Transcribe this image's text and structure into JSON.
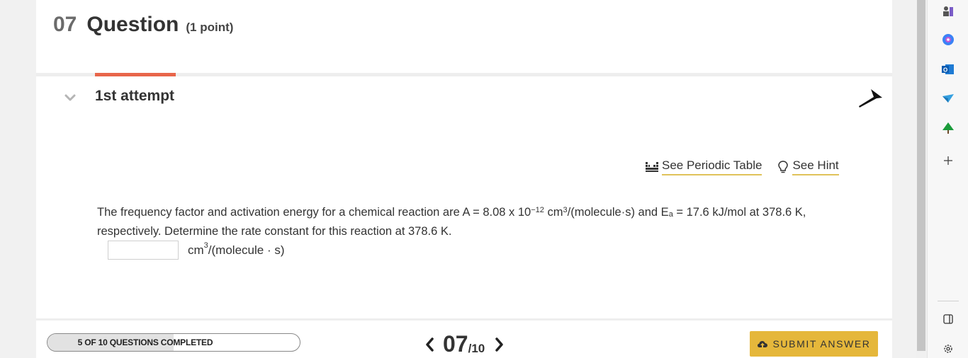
{
  "question": {
    "number": "07",
    "title": "Question",
    "points": "(1 point)",
    "attempt": "1st attempt"
  },
  "links": {
    "periodic_table": "See Periodic Table",
    "hint": "See Hint"
  },
  "body": {
    "t1": "The frequency factor and activation energy for a chemical reaction are A = 8.08  x 10",
    "exp1": "−12",
    "t2": " cm",
    "exp2": "3",
    "t3": "/(molecule·s) and E",
    "sub1": "a",
    "t4": " = 17.6  kJ/mol at 378.6  K, respectively. Determine the rate constant for this reaction at 378.6  K."
  },
  "answer": {
    "value": "",
    "unit_base": "cm",
    "unit_exp": "3",
    "unit_rest": "/(molecule · s)"
  },
  "progress": {
    "label": "5 OF 10 QUESTIONS COMPLETED",
    "completed": 5,
    "total": 10
  },
  "pager": {
    "current": "07",
    "total": "/10"
  },
  "submit_label": "SUBMIT ANSWER",
  "colors": {
    "accent": "#e8654a",
    "submit": "#e5b73b",
    "link_underline": "#e0c25a"
  }
}
